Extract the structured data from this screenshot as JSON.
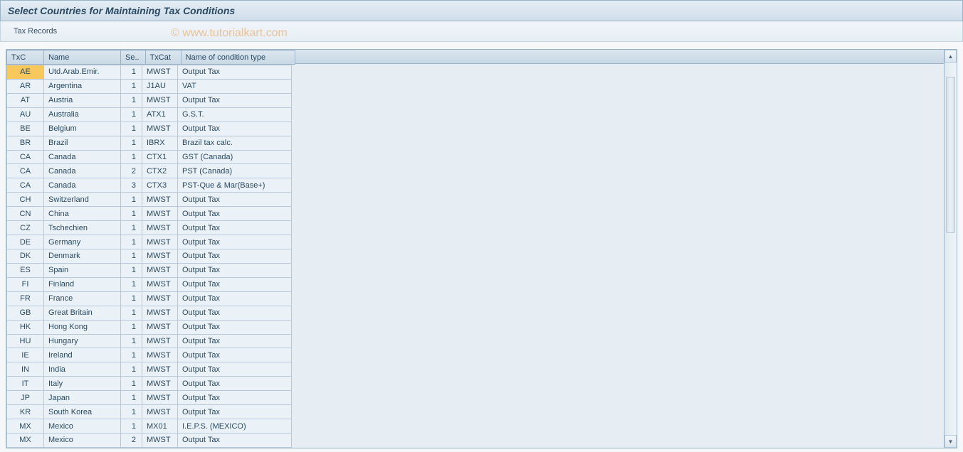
{
  "title": "Select Countries for Maintaining Tax Conditions",
  "toolbar": {
    "tax_records": "Tax Records"
  },
  "watermark": "© www.tutorialkart.com",
  "columns": {
    "txc": "TxC",
    "name": "Name",
    "se": "Se..",
    "txcat": "TxCat",
    "cond": "Name of condition type"
  },
  "rows": [
    {
      "txc": "AE",
      "name": "Utd.Arab.Emir.",
      "se": "1",
      "txcat": "MWST",
      "cond": "Output Tax",
      "selected": true
    },
    {
      "txc": "AR",
      "name": "Argentina",
      "se": "1",
      "txcat": "J1AU",
      "cond": "VAT"
    },
    {
      "txc": "AT",
      "name": "Austria",
      "se": "1",
      "txcat": "MWST",
      "cond": "Output Tax"
    },
    {
      "txc": "AU",
      "name": "Australia",
      "se": "1",
      "txcat": "ATX1",
      "cond": "G.S.T."
    },
    {
      "txc": "BE",
      "name": "Belgium",
      "se": "1",
      "txcat": "MWST",
      "cond": "Output Tax"
    },
    {
      "txc": "BR",
      "name": "Brazil",
      "se": "1",
      "txcat": "IBRX",
      "cond": "Brazil tax calc."
    },
    {
      "txc": "CA",
      "name": "Canada",
      "se": "1",
      "txcat": "CTX1",
      "cond": "GST (Canada)"
    },
    {
      "txc": "CA",
      "name": "Canada",
      "se": "2",
      "txcat": "CTX2",
      "cond": "PST (Canada)"
    },
    {
      "txc": "CA",
      "name": "Canada",
      "se": "3",
      "txcat": "CTX3",
      "cond": "PST-Que & Mar(Base+)"
    },
    {
      "txc": "CH",
      "name": "Switzerland",
      "se": "1",
      "txcat": "MWST",
      "cond": "Output Tax"
    },
    {
      "txc": "CN",
      "name": "China",
      "se": "1",
      "txcat": "MWST",
      "cond": "Output Tax"
    },
    {
      "txc": "CZ",
      "name": "Tschechien",
      "se": "1",
      "txcat": "MWST",
      "cond": "Output Tax"
    },
    {
      "txc": "DE",
      "name": "Germany",
      "se": "1",
      "txcat": "MWST",
      "cond": "Output Tax"
    },
    {
      "txc": "DK",
      "name": "Denmark",
      "se": "1",
      "txcat": "MWST",
      "cond": "Output Tax"
    },
    {
      "txc": "ES",
      "name": "Spain",
      "se": "1",
      "txcat": "MWST",
      "cond": "Output Tax"
    },
    {
      "txc": "FI",
      "name": "Finland",
      "se": "1",
      "txcat": "MWST",
      "cond": "Output Tax"
    },
    {
      "txc": "FR",
      "name": "France",
      "se": "1",
      "txcat": "MWST",
      "cond": "Output Tax"
    },
    {
      "txc": "GB",
      "name": "Great Britain",
      "se": "1",
      "txcat": "MWST",
      "cond": "Output Tax"
    },
    {
      "txc": "HK",
      "name": "Hong Kong",
      "se": "1",
      "txcat": "MWST",
      "cond": "Output Tax"
    },
    {
      "txc": "HU",
      "name": "Hungary",
      "se": "1",
      "txcat": "MWST",
      "cond": "Output Tax"
    },
    {
      "txc": "IE",
      "name": "Ireland",
      "se": "1",
      "txcat": "MWST",
      "cond": "Output Tax"
    },
    {
      "txc": "IN",
      "name": "India",
      "se": "1",
      "txcat": "MWST",
      "cond": "Output Tax"
    },
    {
      "txc": "IT",
      "name": "Italy",
      "se": "1",
      "txcat": "MWST",
      "cond": "Output Tax"
    },
    {
      "txc": "JP",
      "name": "Japan",
      "se": "1",
      "txcat": "MWST",
      "cond": "Output Tax"
    },
    {
      "txc": "KR",
      "name": "South Korea",
      "se": "1",
      "txcat": "MWST",
      "cond": "Output Tax"
    },
    {
      "txc": "MX",
      "name": "Mexico",
      "se": "1",
      "txcat": "MX01",
      "cond": "I.E.P.S.  (MEXICO)"
    },
    {
      "txc": "MX",
      "name": "Mexico",
      "se": "2",
      "txcat": "MWST",
      "cond": "Output Tax"
    }
  ]
}
